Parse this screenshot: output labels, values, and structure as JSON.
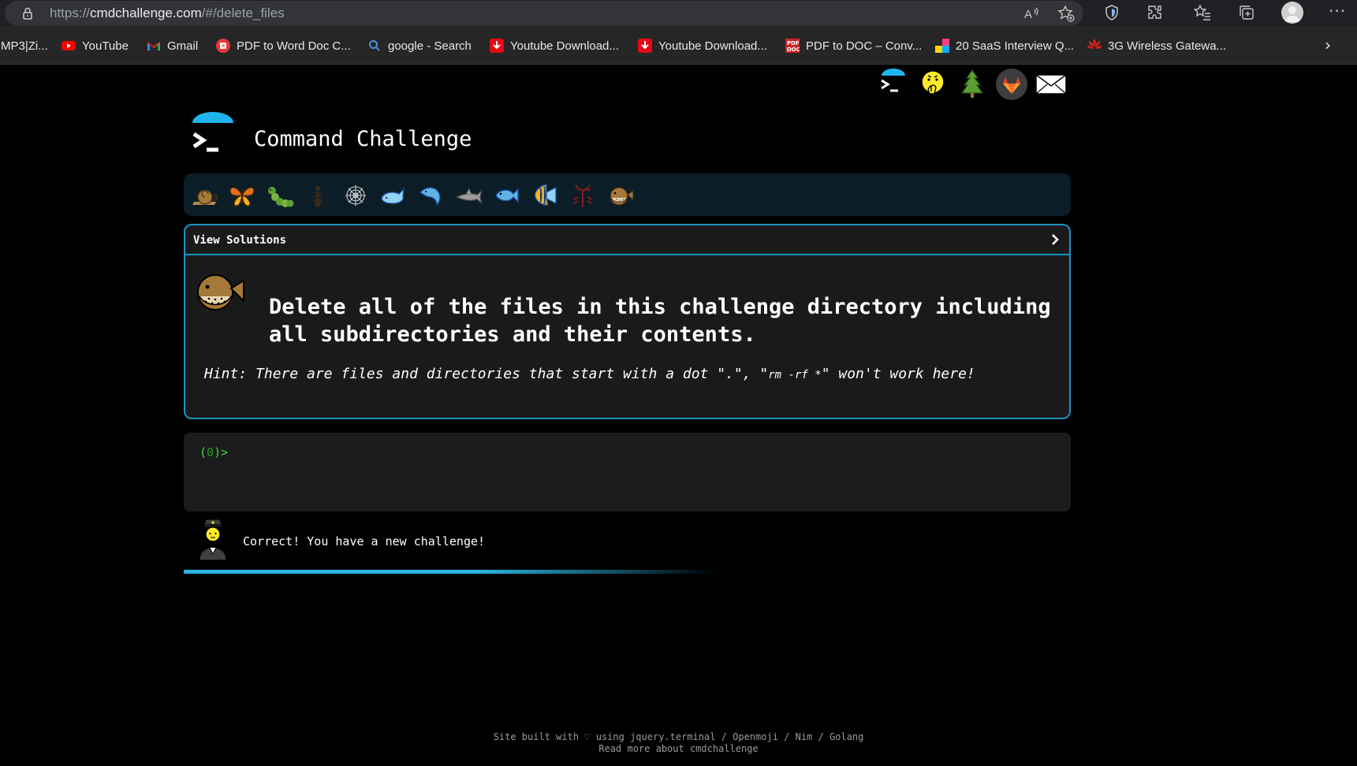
{
  "browser": {
    "url_scheme": "https://",
    "url_host": "cmdchallenge.com",
    "url_path": "/#/delete_files",
    "bookmarks": [
      {
        "label": "MP3|Zi...",
        "icon": "none"
      },
      {
        "label": "YouTube",
        "icon": "youtube-icon"
      },
      {
        "label": "Gmail",
        "icon": "gmail-icon"
      },
      {
        "label": "PDF to Word Doc C...",
        "icon": "pdf-icon"
      },
      {
        "label": "google - Search",
        "icon": "search-icon"
      },
      {
        "label": "Youtube Download...",
        "icon": "download-icon"
      },
      {
        "label": "Youtube Download...",
        "icon": "download-icon"
      },
      {
        "label": "PDF to DOC – Conv...",
        "icon": "pdf-doc-icon"
      },
      {
        "label": "20 SaaS Interview Q...",
        "icon": "saas-icon"
      },
      {
        "label": "3G Wireless Gatewa...",
        "icon": "huawei-icon"
      }
    ]
  },
  "header": {
    "title": "Command Challenge"
  },
  "challenge": {
    "view_solutions_label": "View Solutions",
    "task": "Delete all of the files in this challenge directory including all subdirectories and their contents.",
    "hint_prefix": "Hint: There are files and directories that start with a dot \".\", \"",
    "hint_cmd": "rm -rf *",
    "hint_suffix": "\" won't work here!"
  },
  "terminal": {
    "prompt_open": "(",
    "prompt_num": "0",
    "prompt_close": ")>"
  },
  "status": {
    "message": "Correct! You have a new challenge!",
    "progress_fraction": 0.6
  },
  "footer": {
    "line1": "Site built with ♡ using jquery.terminal / Openmoji / Nim / Golang",
    "line2": "Read more about cmdchallenge"
  },
  "colors": {
    "accent": "#1a93c4",
    "prompt_green": "#3ddc3d",
    "level_bar": "#0b1e28"
  }
}
